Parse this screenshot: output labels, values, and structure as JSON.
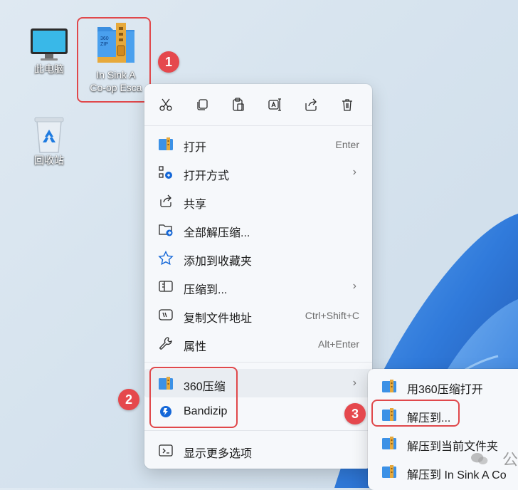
{
  "colors": {
    "accent": "#1467d8",
    "highlight": "#e0484b",
    "menu_bg": "#f6f8fb"
  },
  "desktop": {
    "icons": [
      {
        "label": "此电脑",
        "icon": "monitor-icon"
      },
      {
        "label": "回收站",
        "icon": "recycle-bin-icon"
      }
    ],
    "selected_file": {
      "label_line1": "In Sink A",
      "label_line2": "Co-op Esca",
      "icon": "zip-archive-icon"
    }
  },
  "callouts": [
    "1",
    "2",
    "3"
  ],
  "context_menu": {
    "toolbar": [
      "cut-icon",
      "copy-icon",
      "paste-icon",
      "rename-icon",
      "share-icon",
      "delete-icon"
    ],
    "items": [
      {
        "label": "打开",
        "shortcut": "Enter",
        "icon": "archive-icon"
      },
      {
        "label": "打开方式",
        "shortcut": "",
        "icon": "open-with-icon",
        "submenu": true
      },
      {
        "label": "共享",
        "shortcut": "",
        "icon": "share-icon"
      },
      {
        "label": "全部解压缩...",
        "shortcut": "",
        "icon": "extract-all-icon"
      },
      {
        "label": "添加到收藏夹",
        "shortcut": "",
        "icon": "star-icon"
      },
      {
        "label": "压缩到...",
        "shortcut": "",
        "icon": "compress-icon",
        "submenu": true
      },
      {
        "label": "复制文件地址",
        "shortcut": "Ctrl+Shift+C",
        "icon": "copy-path-icon"
      },
      {
        "label": "属性",
        "shortcut": "Alt+Enter",
        "icon": "wrench-icon"
      },
      {
        "label": "360压缩",
        "shortcut": "",
        "icon": "archive-icon",
        "submenu": true
      },
      {
        "label": "Bandizip",
        "shortcut": "",
        "icon": "bandizip-icon"
      },
      {
        "label": "显示更多选项",
        "shortcut": "",
        "icon": "more-options-icon"
      }
    ]
  },
  "submenu_360": {
    "items": [
      {
        "label": "用360压缩打开"
      },
      {
        "label": "解压到..."
      },
      {
        "label": "解压到当前文件夹"
      },
      {
        "label": "解压到 In Sink A Co"
      }
    ]
  },
  "watermark": {
    "text": "公"
  }
}
